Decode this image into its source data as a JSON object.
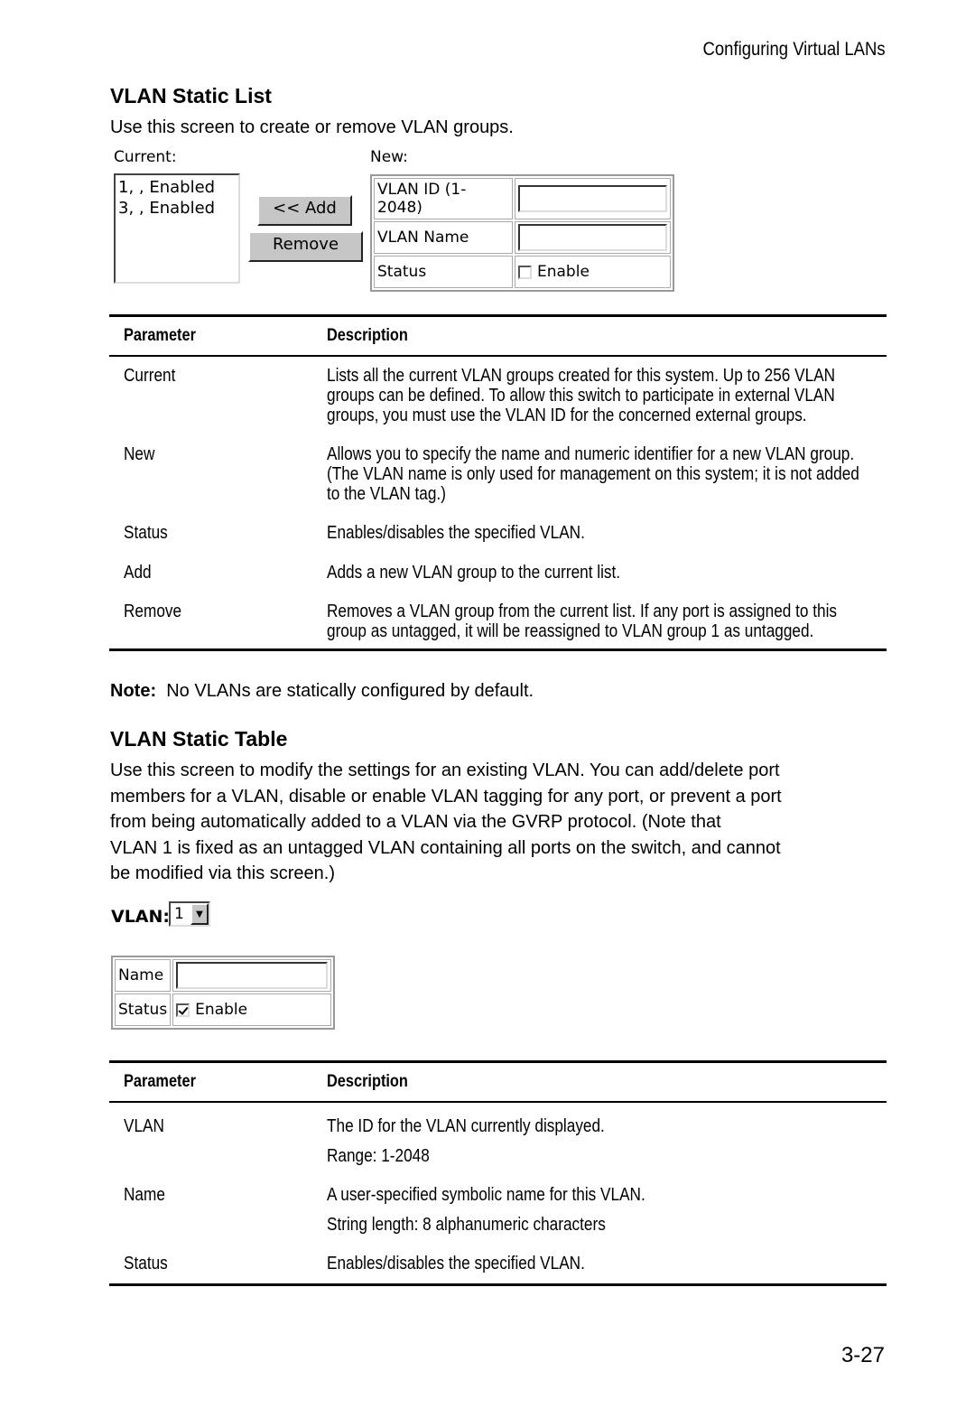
{
  "running_head": "Configuring Virtual LANs",
  "page_number": "3-27",
  "static_list": {
    "title": "VLAN Static List",
    "intro": "Use this screen to create or remove VLAN groups.",
    "ui": {
      "current_label": "Current:",
      "current_items": [
        "1, , Enabled",
        "3, , Enabled"
      ],
      "add_button": "<< Add",
      "remove_button": "Remove",
      "new_label": "New:",
      "vlan_id_label": "VLAN ID (1-2048)",
      "vlan_id_value": "",
      "vlan_name_label": "VLAN Name",
      "vlan_name_value": "",
      "status_label": "Status",
      "enable_label": "Enable",
      "enable_checked": false
    },
    "table": {
      "headers": [
        "Parameter",
        "Description"
      ],
      "rows": [
        {
          "param": "Current",
          "desc": [
            "Lists all the current VLAN groups created for this system. Up to 256 VLAN",
            "groups can be defined. To allow this switch to participate in external VLAN",
            "groups, you must use the VLAN ID for the concerned external groups."
          ]
        },
        {
          "param": "New",
          "desc": [
            "Allows you to specify the name and numeric identifier for a new VLAN group.",
            "(The VLAN name is only used for management on this system; it is not added",
            "to the VLAN tag.)"
          ]
        },
        {
          "param": "Status",
          "desc": [
            "Enables/disables the specified VLAN."
          ]
        },
        {
          "param": "Add",
          "desc": [
            "Adds a new VLAN group to the current list."
          ]
        },
        {
          "param": "Remove",
          "desc": [
            "Removes a VLAN group from the current list. If any port is assigned to this",
            "group as untagged, it will be reassigned to VLAN group 1 as untagged."
          ]
        }
      ]
    },
    "note_label": "Note:",
    "note_text": "No VLANs are statically configured by default."
  },
  "static_table": {
    "title": "VLAN Static Table",
    "intro": [
      "Use this screen to modify the settings for an existing VLAN. You can add/delete port",
      "members for a VLAN, disable or enable VLAN tagging for any port, or prevent a port",
      "from being automatically added to a VLAN via the GVRP protocol. (Note that",
      "VLAN 1 is fixed as an untagged VLAN containing all ports on the switch, and cannot",
      "be modified via this screen.)"
    ],
    "ui": {
      "vlan_label": "VLAN:",
      "vlan_selected": "1",
      "name_label": "Name",
      "name_value": "",
      "status_label": "Status",
      "enable_label": "Enable",
      "enable_checked": true
    },
    "table": {
      "headers": [
        "Parameter",
        "Description"
      ],
      "rows": [
        {
          "param": "VLAN",
          "desc": [
            "The ID for the VLAN currently displayed.",
            "Range: 1-2048"
          ]
        },
        {
          "param": "Name",
          "desc": [
            "A user-specified symbolic name for this VLAN.",
            "String length: 8 alphanumeric characters"
          ]
        },
        {
          "param": "Status",
          "desc": [
            "Enables/disables the specified VLAN."
          ]
        }
      ]
    }
  }
}
